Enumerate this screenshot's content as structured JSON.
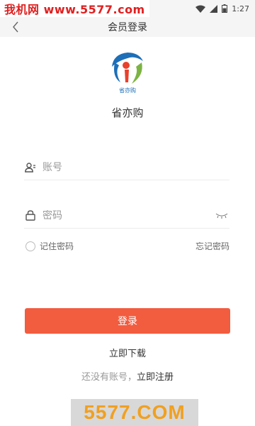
{
  "status_bar": {
    "watermark_text": "我机网 www.5577.com",
    "time": "1:27",
    "battery_level": 0.6
  },
  "nav": {
    "title": "会员登录"
  },
  "logo": {
    "caption": "省亦购",
    "colors": {
      "red": "#e8412c",
      "blue": "#1d6fb8",
      "green": "#7cb342"
    }
  },
  "brand": {
    "name": "省亦购"
  },
  "form": {
    "account_placeholder": "账号",
    "account_value": "",
    "password_placeholder": "密码",
    "password_value": "",
    "remember_label": "记住密码",
    "forgot_label": "忘记密码"
  },
  "actions": {
    "login_label": "登录",
    "download_label": "立即下载",
    "no_account_text": "还没有账号，",
    "register_label": "立即注册"
  },
  "watermark_bottom": {
    "text": "5577.COM"
  },
  "colors": {
    "accent": "#f25c3f",
    "nav_background": "#f5f5f5"
  }
}
